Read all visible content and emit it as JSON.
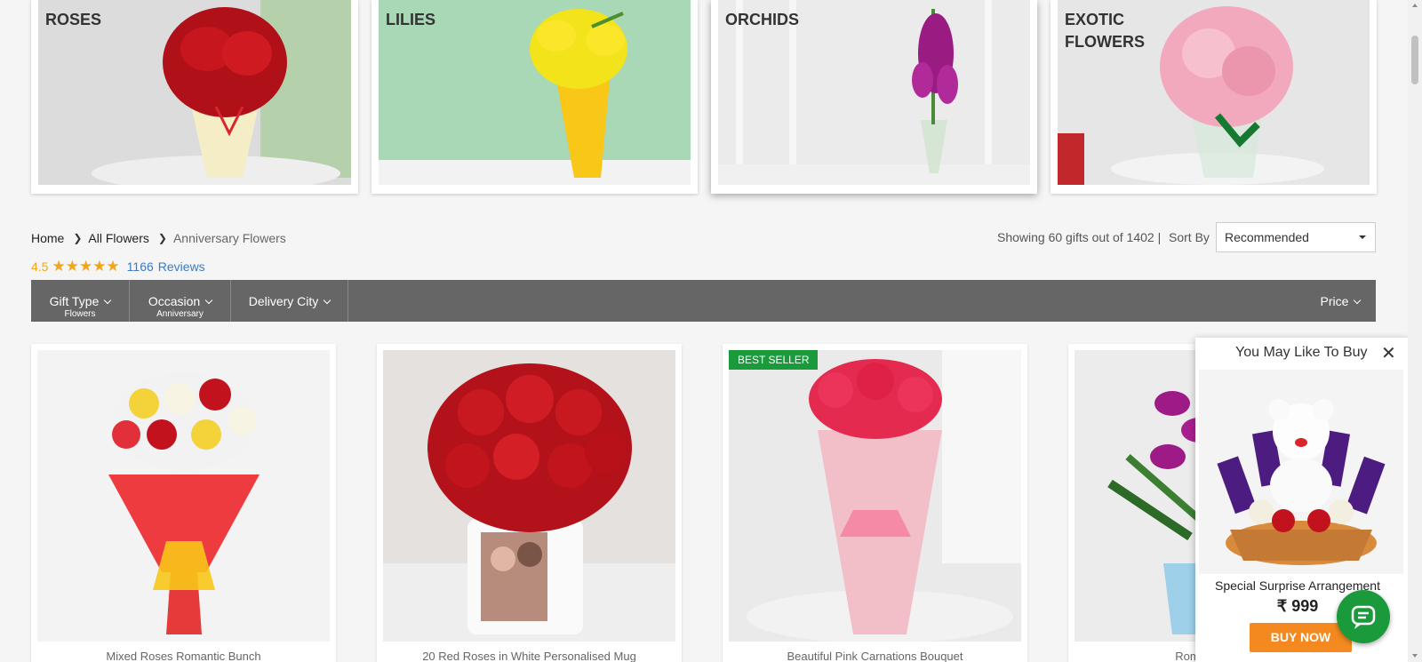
{
  "categories": [
    {
      "title": "ROSES"
    },
    {
      "title": "LILIES"
    },
    {
      "title": "ORCHIDS"
    },
    {
      "title": "EXOTIC FLOWERS"
    }
  ],
  "breadcrumb": {
    "home": "Home",
    "all": "All Flowers",
    "current": "Anniversary Flowers"
  },
  "rating": {
    "score": "4.5",
    "stars": "★★★★★",
    "count": "1166",
    "reviews_label": "Reviews"
  },
  "listing": {
    "showing": "Showing 60 gifts out of 1402 |",
    "sort_label": "Sort By",
    "sort_value": "Recommended"
  },
  "filters": {
    "gift_type": {
      "label": "Gift Type",
      "value": "Flowers"
    },
    "occasion": {
      "label": "Occasion",
      "value": "Anniversary"
    },
    "delivery_city": {
      "label": "Delivery City"
    },
    "price": {
      "label": "Price"
    }
  },
  "products": [
    {
      "name": "Mixed Roses Romantic Bunch"
    },
    {
      "name": "20 Red Roses in White Personalised Mug"
    },
    {
      "name": "Beautiful Pink Carnations Bouquet",
      "badge": "BEST SELLER"
    },
    {
      "name": "Romantic Heart S"
    }
  ],
  "popup": {
    "title": "You May Like To Buy",
    "close": "✕",
    "product_name": "Special Surprise Arrangement",
    "price": "₹ 999",
    "buy_label": "BUY NOW"
  },
  "colors": {
    "filter_bar": "#666666",
    "star": "#f3a51a",
    "link": "#3d7bbf",
    "badge": "#1a9a3b",
    "buy": "#f48a1f"
  }
}
